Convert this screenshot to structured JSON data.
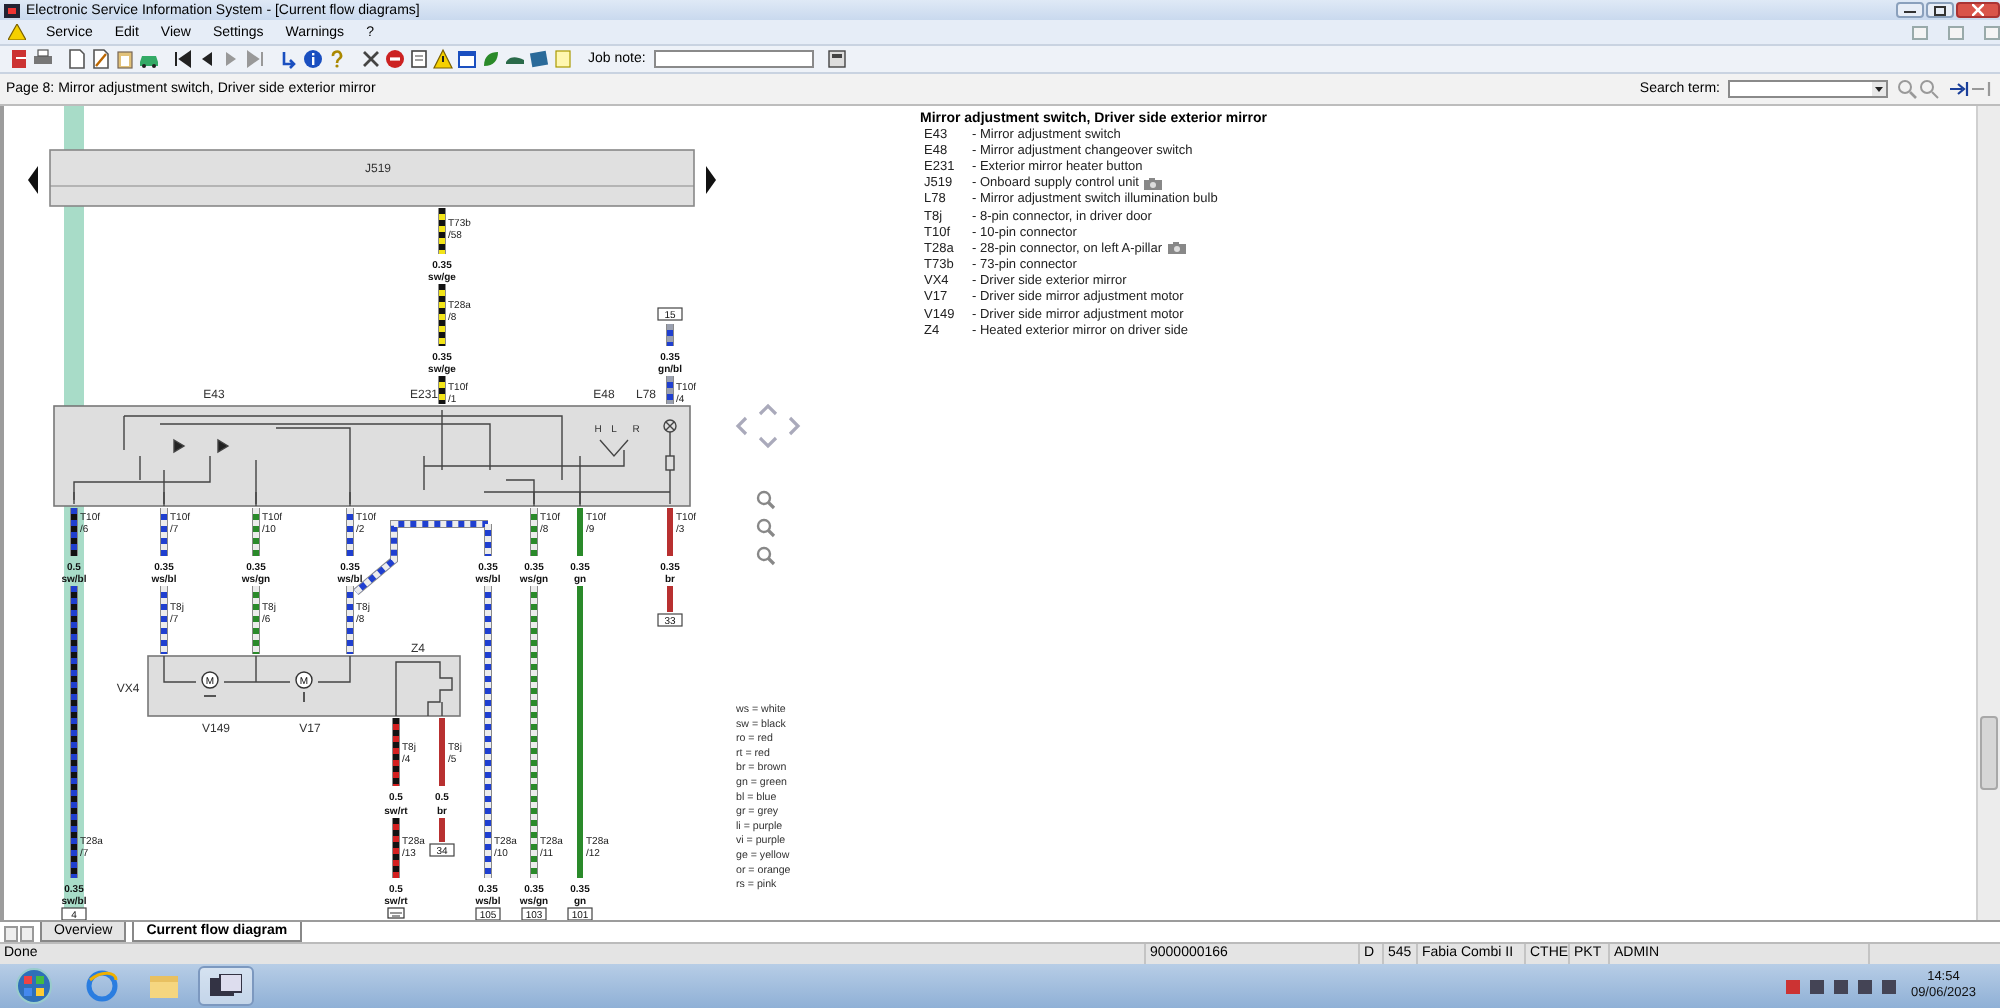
{
  "window": {
    "title": "Electronic Service Information System - [Current flow diagrams]"
  },
  "menu": [
    "Service",
    "Edit",
    "View",
    "Settings",
    "Warnings",
    "?"
  ],
  "toolbar": {
    "job_note_label": "Job note:"
  },
  "page_header": {
    "title": "Page 8: Mirror adjustment switch, Driver side exterior mirror",
    "search_label": "Search term:"
  },
  "diagram": {
    "components": [
      {
        "label": "J519"
      },
      {
        "label": "E43"
      },
      {
        "label": "E231"
      },
      {
        "label": "E48"
      },
      {
        "label": "L78"
      },
      {
        "label": "VX4"
      },
      {
        "label": "Z4"
      }
    ],
    "motors": [
      {
        "symbol": "M",
        "label": "V149"
      },
      {
        "symbol": "M",
        "label": "V17"
      }
    ],
    "switch_positions": [
      "H",
      "L",
      "R"
    ],
    "wires": [
      {
        "kind": "plain",
        "color": "#f2e418",
        "stripe": {
          "color": "#111111"
        },
        "labels": [
          {
            "kind": "connector",
            "text": "T73b"
          },
          {
            "kind": "connector",
            "text": "/58"
          },
          {
            "kind": "wire",
            "text": "0.35"
          },
          {
            "kind": "wire",
            "text": "sw/ge"
          },
          {
            "kind": "connector",
            "text": "T28a"
          },
          {
            "kind": "connector",
            "text": "/8"
          },
          {
            "kind": "wire",
            "text": "0.35"
          },
          {
            "kind": "wire",
            "text": "sw/ge"
          },
          {
            "kind": "connector",
            "text": "T10f"
          },
          {
            "kind": "connector",
            "text": "/1"
          }
        ]
      },
      {
        "kind": "plain",
        "color": "#1f3fd0",
        "stripe": {
          "color": "#9aa0b0"
        },
        "labels": [
          {
            "kind": "terminal",
            "text": "15"
          },
          {
            "kind": "wire",
            "text": "0.35"
          },
          {
            "kind": "wire",
            "text": "gn/bl"
          },
          {
            "kind": "connector",
            "text": "T10f"
          },
          {
            "kind": "connector",
            "text": "/4"
          }
        ]
      },
      {
        "kind": "plain",
        "color": "#111111",
        "stripe": {
          "color": "#1f3fd0"
        },
        "labels": [
          {
            "kind": "connector",
            "text": "T10f"
          },
          {
            "kind": "connector",
            "text": "/6"
          },
          {
            "kind": "wire",
            "text": "0.5"
          },
          {
            "kind": "wire",
            "text": "sw/bl"
          },
          {
            "kind": "connector",
            "text": "T28a"
          },
          {
            "kind": "connector",
            "text": "/7"
          },
          {
            "kind": "wire",
            "text": "0.35"
          },
          {
            "kind": "wire",
            "text": "sw/bl"
          },
          {
            "kind": "terminal",
            "text": "4"
          }
        ]
      },
      {
        "kind": "plain",
        "color": "#1f3fd0",
        "stripe": {
          "color": "#ececec"
        },
        "labels": [
          {
            "kind": "connector",
            "text": "T10f"
          },
          {
            "kind": "connector",
            "text": "/7"
          },
          {
            "kind": "wire",
            "text": "0.35"
          },
          {
            "kind": "wire",
            "text": "ws/bl"
          },
          {
            "kind": "connector",
            "text": "T8j"
          },
          {
            "kind": "connector",
            "text": "/7"
          }
        ]
      },
      {
        "kind": "plain",
        "color": "#2a8a2a",
        "stripe": {
          "color": "#ececec"
        },
        "labels": [
          {
            "kind": "connector",
            "text": "T10f"
          },
          {
            "kind": "connector",
            "text": "/10"
          },
          {
            "kind": "wire",
            "text": "0.35"
          },
          {
            "kind": "wire",
            "text": "ws/gn"
          },
          {
            "kind": "connector",
            "text": "T8j"
          },
          {
            "kind": "connector",
            "text": "/6"
          }
        ]
      },
      {
        "kind": "plain",
        "color": "#1f3fd0",
        "stripe": {
          "color": "#ececec"
        },
        "labels": [
          {
            "kind": "connector",
            "text": "T10f"
          },
          {
            "kind": "connector",
            "text": "/2"
          },
          {
            "kind": "wire",
            "text": "0.35"
          },
          {
            "kind": "wire",
            "text": "ws/bl"
          },
          {
            "kind": "connector",
            "text": "T8j"
          },
          {
            "kind": "connector",
            "text": "/8"
          }
        ]
      },
      {
        "kind": "plain",
        "color": "#1f3fd0",
        "stripe": {
          "color": "#ececec"
        },
        "labels": [
          {
            "kind": "wire",
            "text": "0.35"
          },
          {
            "kind": "wire",
            "text": "ws/bl"
          },
          {
            "kind": "connector",
            "text": "T28a"
          },
          {
            "kind": "connector",
            "text": "/10"
          },
          {
            "kind": "wire",
            "text": "0.35"
          },
          {
            "kind": "wire",
            "text": "ws/bl"
          },
          {
            "kind": "terminal",
            "text": "105"
          }
        ]
      },
      {
        "kind": "plain",
        "color": "#2a8a2a",
        "stripe": {
          "color": "#ececec"
        },
        "labels": [
          {
            "kind": "connector",
            "text": "T10f"
          },
          {
            "kind": "connector",
            "text": "/8"
          },
          {
            "kind": "wire",
            "text": "0.35"
          },
          {
            "kind": "wire",
            "text": "ws/gn"
          },
          {
            "kind": "connector",
            "text": "T28a"
          },
          {
            "kind": "connector",
            "text": "/11"
          },
          {
            "kind": "wire",
            "text": "0.35"
          },
          {
            "kind": "wire",
            "text": "ws/gn"
          },
          {
            "kind": "terminal",
            "text": "103"
          }
        ]
      },
      {
        "kind": "plain",
        "color": "#2a8a2a",
        "labels": [
          {
            "kind": "connector",
            "text": "T10f"
          },
          {
            "kind": "connector",
            "text": "/9"
          },
          {
            "kind": "wire",
            "text": "0.35"
          },
          {
            "kind": "wire",
            "text": "gn"
          },
          {
            "kind": "connector",
            "text": "T28a"
          },
          {
            "kind": "connector",
            "text": "/12"
          },
          {
            "kind": "wire",
            "text": "0.35"
          },
          {
            "kind": "wire",
            "text": "gn"
          },
          {
            "kind": "terminal",
            "text": "101"
          }
        ]
      },
      {
        "kind": "plain",
        "color": "#b83030",
        "labels": [
          {
            "kind": "connector",
            "text": "T10f"
          },
          {
            "kind": "connector",
            "text": "/3"
          },
          {
            "kind": "wire",
            "text": "0.35"
          },
          {
            "kind": "wire",
            "text": "br"
          },
          {
            "kind": "terminal",
            "text": "33"
          }
        ]
      },
      {
        "kind": "grounded",
        "color": "#d42020",
        "stripe": {
          "color": "#111111"
        },
        "labels": [
          {
            "kind": "connector",
            "text": "T8j"
          },
          {
            "kind": "connector",
            "text": "/4"
          },
          {
            "kind": "wire",
            "text": "0.5"
          },
          {
            "kind": "wire",
            "text": "sw/rt"
          },
          {
            "kind": "connector",
            "text": "T28a"
          },
          {
            "kind": "connector",
            "text": "/13"
          },
          {
            "kind": "wire",
            "text": "0.5"
          },
          {
            "kind": "wire",
            "text": "sw/rt"
          }
        ]
      },
      {
        "kind": "plain",
        "color": "#b83030",
        "labels": [
          {
            "kind": "connector",
            "text": "T8j"
          },
          {
            "kind": "connector",
            "text": "/5"
          },
          {
            "kind": "wire",
            "text": "0.5"
          },
          {
            "kind": "wire",
            "text": "br"
          },
          {
            "kind": "terminal",
            "text": "34"
          }
        ]
      }
    ],
    "color_key": [
      "ws = white",
      "sw = black",
      "ro = red",
      "rt = red",
      "br = brown",
      "gn = green",
      "bl = blue",
      "gr = grey",
      "li = purple",
      "vi = purple",
      "ge = yellow",
      "or = orange",
      "rs = pink"
    ]
  },
  "legend": {
    "title": "Mirror adjustment switch, Driver side exterior mirror",
    "items": [
      {
        "code": "E43",
        "text": "- Mirror adjustment switch",
        "camera": false
      },
      {
        "code": "E48",
        "text": "- Mirror adjustment changeover switch",
        "camera": false
      },
      {
        "code": "E231",
        "text": "- Exterior mirror heater button",
        "camera": false
      },
      {
        "code": "J519",
        "text": "- Onboard supply control unit",
        "camera": true
      },
      {
        "code": "L78",
        "text": "- Mirror adjustment switch illumination bulb",
        "camera": false
      },
      {
        "code": "T8j",
        "text": "- 8-pin connector, in driver door",
        "camera": false
      },
      {
        "code": "T10f",
        "text": "- 10-pin connector",
        "camera": false
      },
      {
        "code": "T28a",
        "text": "- 28-pin connector, on left A-pillar",
        "camera": true
      },
      {
        "code": "T73b",
        "text": "- 73-pin connector",
        "camera": false
      },
      {
        "code": "VX4",
        "text": "- Driver side exterior mirror",
        "camera": false
      },
      {
        "code": "V17",
        "text": "- Driver side mirror adjustment motor",
        "camera": false
      },
      {
        "code": "V149",
        "text": "- Driver side mirror adjustment motor",
        "camera": false
      },
      {
        "code": "Z4",
        "text": "- Heated exterior mirror on driver side",
        "camera": false
      }
    ]
  },
  "tabs": [
    {
      "label": "Overview",
      "selected": false
    },
    {
      "label": "Current flow diagram",
      "selected": true
    }
  ],
  "status_bar": [
    "Done",
    "9000000166",
    "D",
    "545",
    "Fabia Combi II",
    "CTHE",
    "PKT",
    "ADMIN"
  ],
  "taskbar": {
    "time": "14:54",
    "date": "09/06/2023"
  }
}
